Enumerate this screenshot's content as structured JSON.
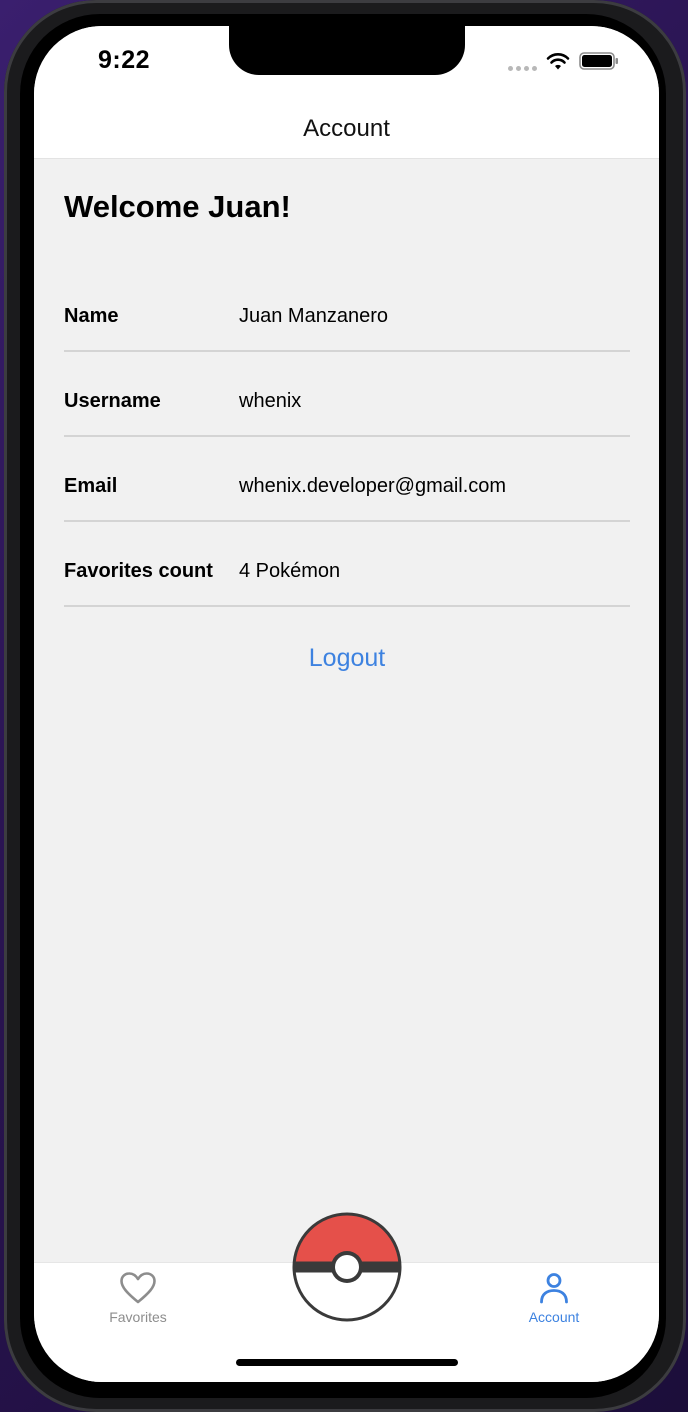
{
  "status_bar": {
    "time": "9:22"
  },
  "nav": {
    "title": "Account"
  },
  "account": {
    "welcome": "Welcome Juan!",
    "rows": [
      {
        "label": "Name",
        "value": "Juan Manzanero"
      },
      {
        "label": "Username",
        "value": "whenix"
      },
      {
        "label": "Email",
        "value": "whenix.developer@gmail.com"
      },
      {
        "label": "Favorites count",
        "value": "4 Pokémon"
      }
    ],
    "logout_label": "Logout"
  },
  "tab_bar": {
    "favorites_label": "Favorites",
    "account_label": "Account",
    "center_icon": "pokeball-icon",
    "active_tab": "Account"
  },
  "colors": {
    "accent": "#3d82e0",
    "inactive_tab": "#8d8d8d",
    "background": "#f1f1f1",
    "pokeball_red": "#e5504a"
  }
}
